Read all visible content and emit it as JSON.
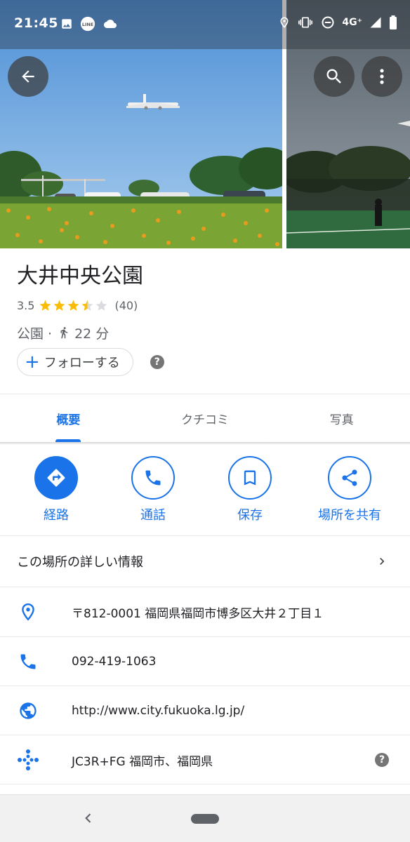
{
  "status_bar": {
    "time": "21:45",
    "network": "4G⁺"
  },
  "place": {
    "title": "大井中央公園",
    "rating": "3.5",
    "rating_value": 3.5,
    "review_count": "(40)",
    "category": "公園 ·",
    "walk_time": "22 分",
    "follow_label": "フォローする"
  },
  "tabs": [
    {
      "label": "概要",
      "active": true
    },
    {
      "label": "クチコミ",
      "active": false
    },
    {
      "label": "写真",
      "active": false
    }
  ],
  "actions": [
    {
      "label": "経路",
      "icon": "directions-icon"
    },
    {
      "label": "通話",
      "icon": "phone-icon"
    },
    {
      "label": "保存",
      "icon": "bookmark-icon"
    },
    {
      "label": "場所を共有",
      "icon": "share-icon"
    }
  ],
  "details": {
    "more_info_label": "この場所の詳しい情報",
    "address": "〒812-0001 福岡県福岡市博多区大井２丁目１",
    "phone": "092-419-1063",
    "website": "http://www.city.fukuoka.lg.jp/",
    "plus_code": "JC3R+FG 福岡市、福岡県"
  },
  "colors": {
    "accent": "#1a73e8",
    "star": "#fbbc04",
    "star_empty": "#dadce0"
  }
}
